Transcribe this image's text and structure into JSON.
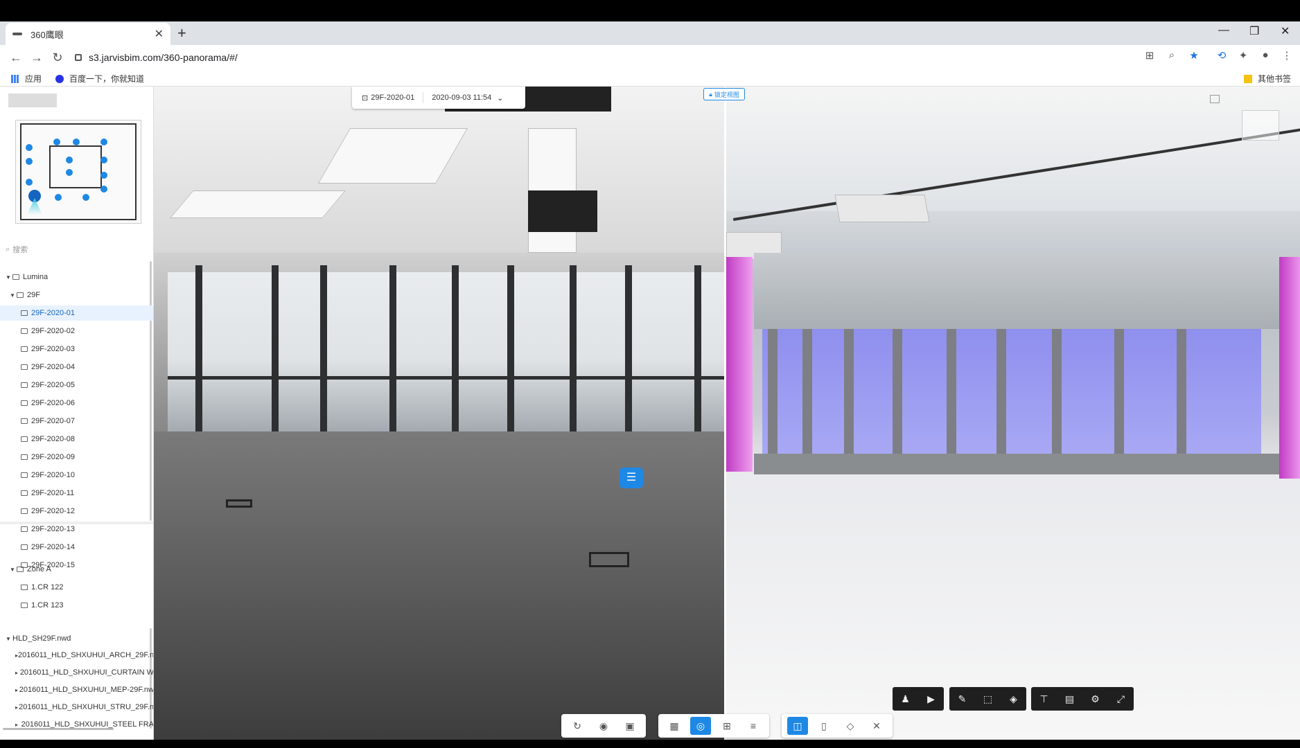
{
  "browser": {
    "tab_title": "360鹰眼",
    "url": "s3.jarvisbim.com/360-panorama/#/",
    "bookmarks": [
      "应用",
      "百度一下，你就知道"
    ],
    "other_bookmarks": "其他书签"
  },
  "sidebar": {
    "search_placeholder": "搜索",
    "project": "Lumina",
    "floor": "29F",
    "captures": [
      "29F-2020-01",
      "29F-2020-02",
      "29F-2020-03",
      "29F-2020-04",
      "29F-2020-05",
      "29F-2020-06",
      "29F-2020-07",
      "29F-2020-08",
      "29F-2020-09",
      "29F-2020-10",
      "29F-2020-11",
      "29F-2020-12",
      "29F-2020-13",
      "29F-2020-14",
      "29F-2020-15"
    ],
    "zone": "Zone A",
    "zone_items": [
      "1.CR 122",
      "1.CR 123"
    ],
    "model_file": "HLD_SH29F.nwd",
    "model_children": [
      "2016011_HLD_SHXUHUI_ARCH_29F.n",
      "2016011_HLD_SHXUHUI_CURTAIN W",
      "2016011_HLD_SHXUHUI_MEP-29F.nw",
      "2016011_HLD_SHXUHUI_STRU_29F.n",
      "2016011_HLD_SHXUHUI_STEEL FRA"
    ]
  },
  "pano": {
    "capture_label": "29F-2020-01",
    "date_label": "2020-09-03 11:54",
    "lock_label": "锁定视图"
  },
  "icons": {
    "bim_toolbar": [
      "person-icon",
      "camera-icon",
      "pencil-icon",
      "box-add-icon",
      "cube-icon",
      "tree-icon",
      "file-icon",
      "gear-icon",
      "fullscreen-icon"
    ],
    "bottom_toolbar": [
      "rotate-icon",
      "eye-icon",
      "annotation-icon",
      "image-icon",
      "panorama-icon",
      "grid-icon",
      "list-icon",
      "split-view-icon",
      "single-view-icon",
      "layers-icon",
      "close-icon"
    ]
  },
  "colors": {
    "accent": "#1e88e5",
    "bim_column": "#d24fd2",
    "bim_glass": "#9a9af2"
  }
}
